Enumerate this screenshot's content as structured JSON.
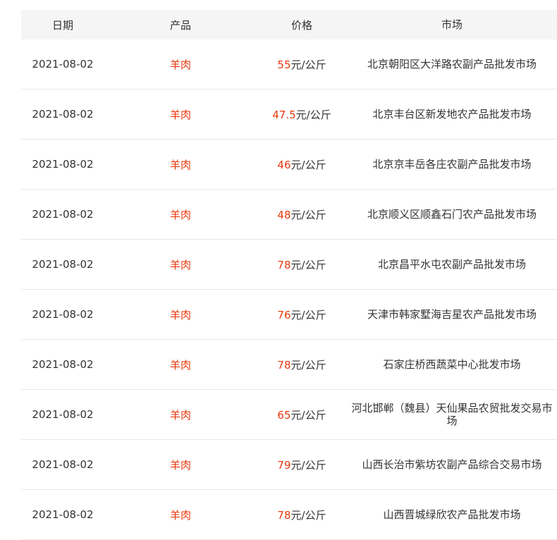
{
  "table": {
    "headers": [
      "日期",
      "产品",
      "价格",
      "市场"
    ],
    "rows": [
      {
        "date": "2021-08-02",
        "product": "羊肉",
        "price": "55",
        "unit": "元/公斤",
        "market": "北京朝阳区大洋路农副产品批发市场"
      },
      {
        "date": "2021-08-02",
        "product": "羊肉",
        "price": "47.5",
        "unit": "元/公斤",
        "market": "北京丰台区新发地农产品批发市场"
      },
      {
        "date": "2021-08-02",
        "product": "羊肉",
        "price": "46",
        "unit": "元/公斤",
        "market": "北京京丰岳各庄农副产品批发市场"
      },
      {
        "date": "2021-08-02",
        "product": "羊肉",
        "price": "48",
        "unit": "元/公斤",
        "market": "北京顺义区顺鑫石门农产品批发市场"
      },
      {
        "date": "2021-08-02",
        "product": "羊肉",
        "price": "78",
        "unit": "元/公斤",
        "market": "北京昌平水屯农副产品批发市场"
      },
      {
        "date": "2021-08-02",
        "product": "羊肉",
        "price": "76",
        "unit": "元/公斤",
        "market": "天津市韩家墅海吉星农产品批发市场"
      },
      {
        "date": "2021-08-02",
        "product": "羊肉",
        "price": "78",
        "unit": "元/公斤",
        "market": "石家庄桥西蔬菜中心批发市场"
      },
      {
        "date": "2021-08-02",
        "product": "羊肉",
        "price": "65",
        "unit": "元/公斤",
        "market": "河北邯郸（魏县）天仙果品农贸批发交易市场"
      },
      {
        "date": "2021-08-02",
        "product": "羊肉",
        "price": "79",
        "unit": "元/公斤",
        "market": "山西长治市紫坊农副产品综合交易市场"
      },
      {
        "date": "2021-08-02",
        "product": "羊肉",
        "price": "78",
        "unit": "元/公斤",
        "market": "山西晋城绿欣农产品批发市场"
      }
    ]
  }
}
